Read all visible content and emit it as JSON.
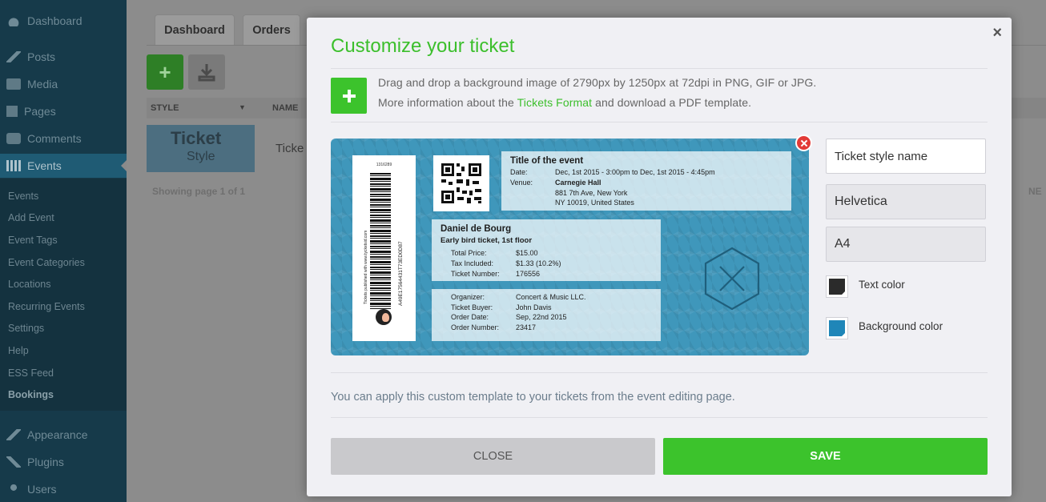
{
  "sidebar": {
    "menu": [
      {
        "label": "Dashboard"
      },
      {
        "label": "Posts"
      },
      {
        "label": "Media"
      },
      {
        "label": "Pages"
      },
      {
        "label": "Comments"
      },
      {
        "label": "Events"
      },
      {
        "label": "Appearance"
      },
      {
        "label": "Plugins"
      },
      {
        "label": "Users"
      }
    ],
    "submenu": [
      {
        "label": "Events"
      },
      {
        "label": "Add Event"
      },
      {
        "label": "Event Tags"
      },
      {
        "label": "Event Categories"
      },
      {
        "label": "Locations"
      },
      {
        "label": "Recurring Events"
      },
      {
        "label": "Settings"
      },
      {
        "label": "Help"
      },
      {
        "label": "ESS Feed"
      },
      {
        "label": "Bookings"
      }
    ]
  },
  "background": {
    "tabs": [
      "Dashboard",
      "Orders"
    ],
    "columns": [
      "STYLE",
      "NAME"
    ],
    "thumb_title": "Ticket",
    "thumb_sub": "Style",
    "row_text": "Ticke",
    "paging": "Showing page 1 of 1",
    "next": "NE"
  },
  "modal": {
    "title": "Customize your ticket",
    "close_symbol": "×",
    "info_line1": "Drag and drop a background image of 2790px by 1250px at 72dpi in PNG, GIF or JPG.",
    "info_line2_pre": "More information about the ",
    "info_link": "Tickets Format",
    "info_line2_post": " and download a PDF template.",
    "note": "You can apply this custom template to your tickets from the event editing page.",
    "close_label": "CLOSE",
    "save_label": "SAVE"
  },
  "ticket": {
    "stub_number": "1316289",
    "stub_code": "A49E17564431T73ED0D87",
    "stub_small": "Tickets published with www.tycketsid.com",
    "event_title": "Title of the event",
    "date_label": "Date:",
    "date_value": "Dec, 1st 2015 - 3:00pm to Dec, 1st 2015 - 4:45pm",
    "venue_label": "Venue:",
    "venue_name": "Carnegie Hall",
    "venue_addr1": "881 7th Ave, New York",
    "venue_addr2": "NY 10019, United States",
    "attendee": "Daniel de Bourg",
    "ticket_type": "Early bird ticket, 1st floor",
    "price_label": "Total Price:",
    "price_value": "$15.00",
    "tax_label": "Tax Included:",
    "tax_value": "$1.33  (10.2%)",
    "ticket_num_label": "Ticket Number:",
    "ticket_num_value": "176556",
    "organizer_label": "Organizer:",
    "organizer_value": "Concert & Music LLC.",
    "buyer_label": "Ticket Buyer:",
    "buyer_value": "John Davis",
    "order_date_label": "Order Date:",
    "order_date_value": "Sep, 22nd 2015",
    "order_num_label": "Order Number:",
    "order_num_value": "23417",
    "background_color": "#3f97bb"
  },
  "settings": {
    "style_name_placeholder": "Ticket style name",
    "font": "Helvetica",
    "paper": "A4",
    "text_color_label": "Text color",
    "text_color": "#2b2b2b",
    "bg_color_label": "Background color",
    "bg_color": "#1f86b8"
  },
  "colors": {
    "accent": "#3cc32c"
  }
}
